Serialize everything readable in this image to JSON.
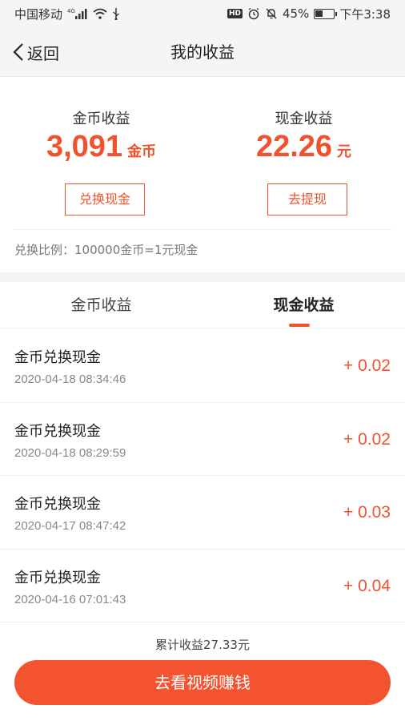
{
  "status_bar": {
    "carrier": "中国移动",
    "network": "4G",
    "hd": "HD",
    "battery_percent": "45%",
    "battery_level": 0.45,
    "time": "下午3:38"
  },
  "nav": {
    "back_label": "返回",
    "title": "我的收益"
  },
  "summary": {
    "coin": {
      "label": "金币收益",
      "amount": "3,091",
      "unit": "金币",
      "button": "兑换现金"
    },
    "cash": {
      "label": "现金收益",
      "amount": "22.26",
      "unit": "元",
      "button": "去提现"
    },
    "ratio": "兑换比例：100000金币=1元现金"
  },
  "tabs": [
    {
      "label": "金币收益",
      "active": false
    },
    {
      "label": "现金收益",
      "active": true
    }
  ],
  "records": [
    {
      "title": "金币兑换现金",
      "time": "2020-04-18 08:34:46",
      "amount": "+ 0.02"
    },
    {
      "title": "金币兑换现金",
      "time": "2020-04-18 08:29:59",
      "amount": "+ 0.02"
    },
    {
      "title": "金币兑换现金",
      "time": "2020-04-17 08:47:42",
      "amount": "+ 0.03"
    },
    {
      "title": "金币兑换现金",
      "time": "2020-04-16 07:01:43",
      "amount": "+ 0.04"
    }
  ],
  "footer": {
    "total": "累计收益27.33元",
    "action_button": "去看视频赚钱"
  },
  "colors": {
    "accent": "#f0522f",
    "button_bg": "#f4532f"
  }
}
